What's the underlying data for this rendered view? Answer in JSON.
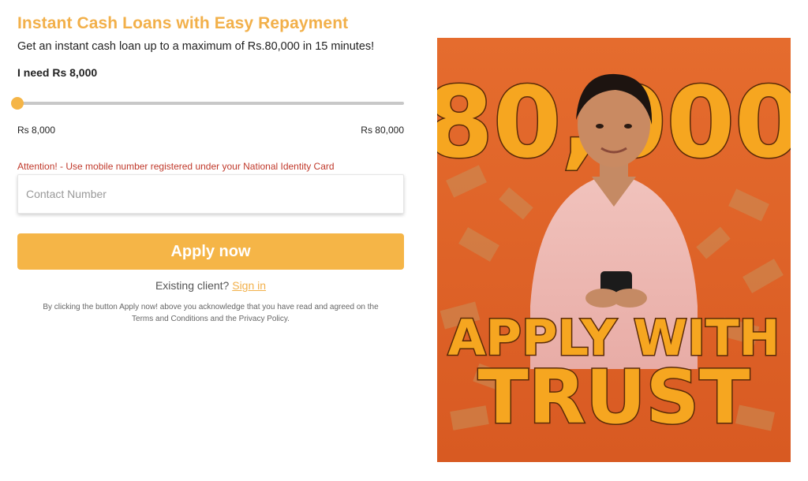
{
  "header": {
    "title": "Instant Cash Loans with Easy Repayment",
    "subtitle": "Get an instant cash loan up to a maximum of Rs.80,000 in 15 minutes!"
  },
  "loan": {
    "need_label": "I need Rs 8,000",
    "slider_fraction": 0,
    "min_label": "Rs 8,000",
    "max_label": "Rs 80,000",
    "accent_color": "#f5b547"
  },
  "form": {
    "attention": "Attention! - Use mobile number registered under your National Identity Card",
    "contact_placeholder": "Contact Number",
    "contact_value": "",
    "apply_label": "Apply now",
    "existing_text": "Existing client?",
    "signin_label": "Sign in",
    "terms_line1": "By clicking the button Apply now! above you acknowledge that you have read and agreed on the",
    "terms_line2": "Terms and Conditions and the Privacy Policy."
  },
  "promo": {
    "amount": "80,000",
    "line1": "APPLY WITH",
    "line2": "TRUST",
    "background_color": "#e0642a"
  }
}
